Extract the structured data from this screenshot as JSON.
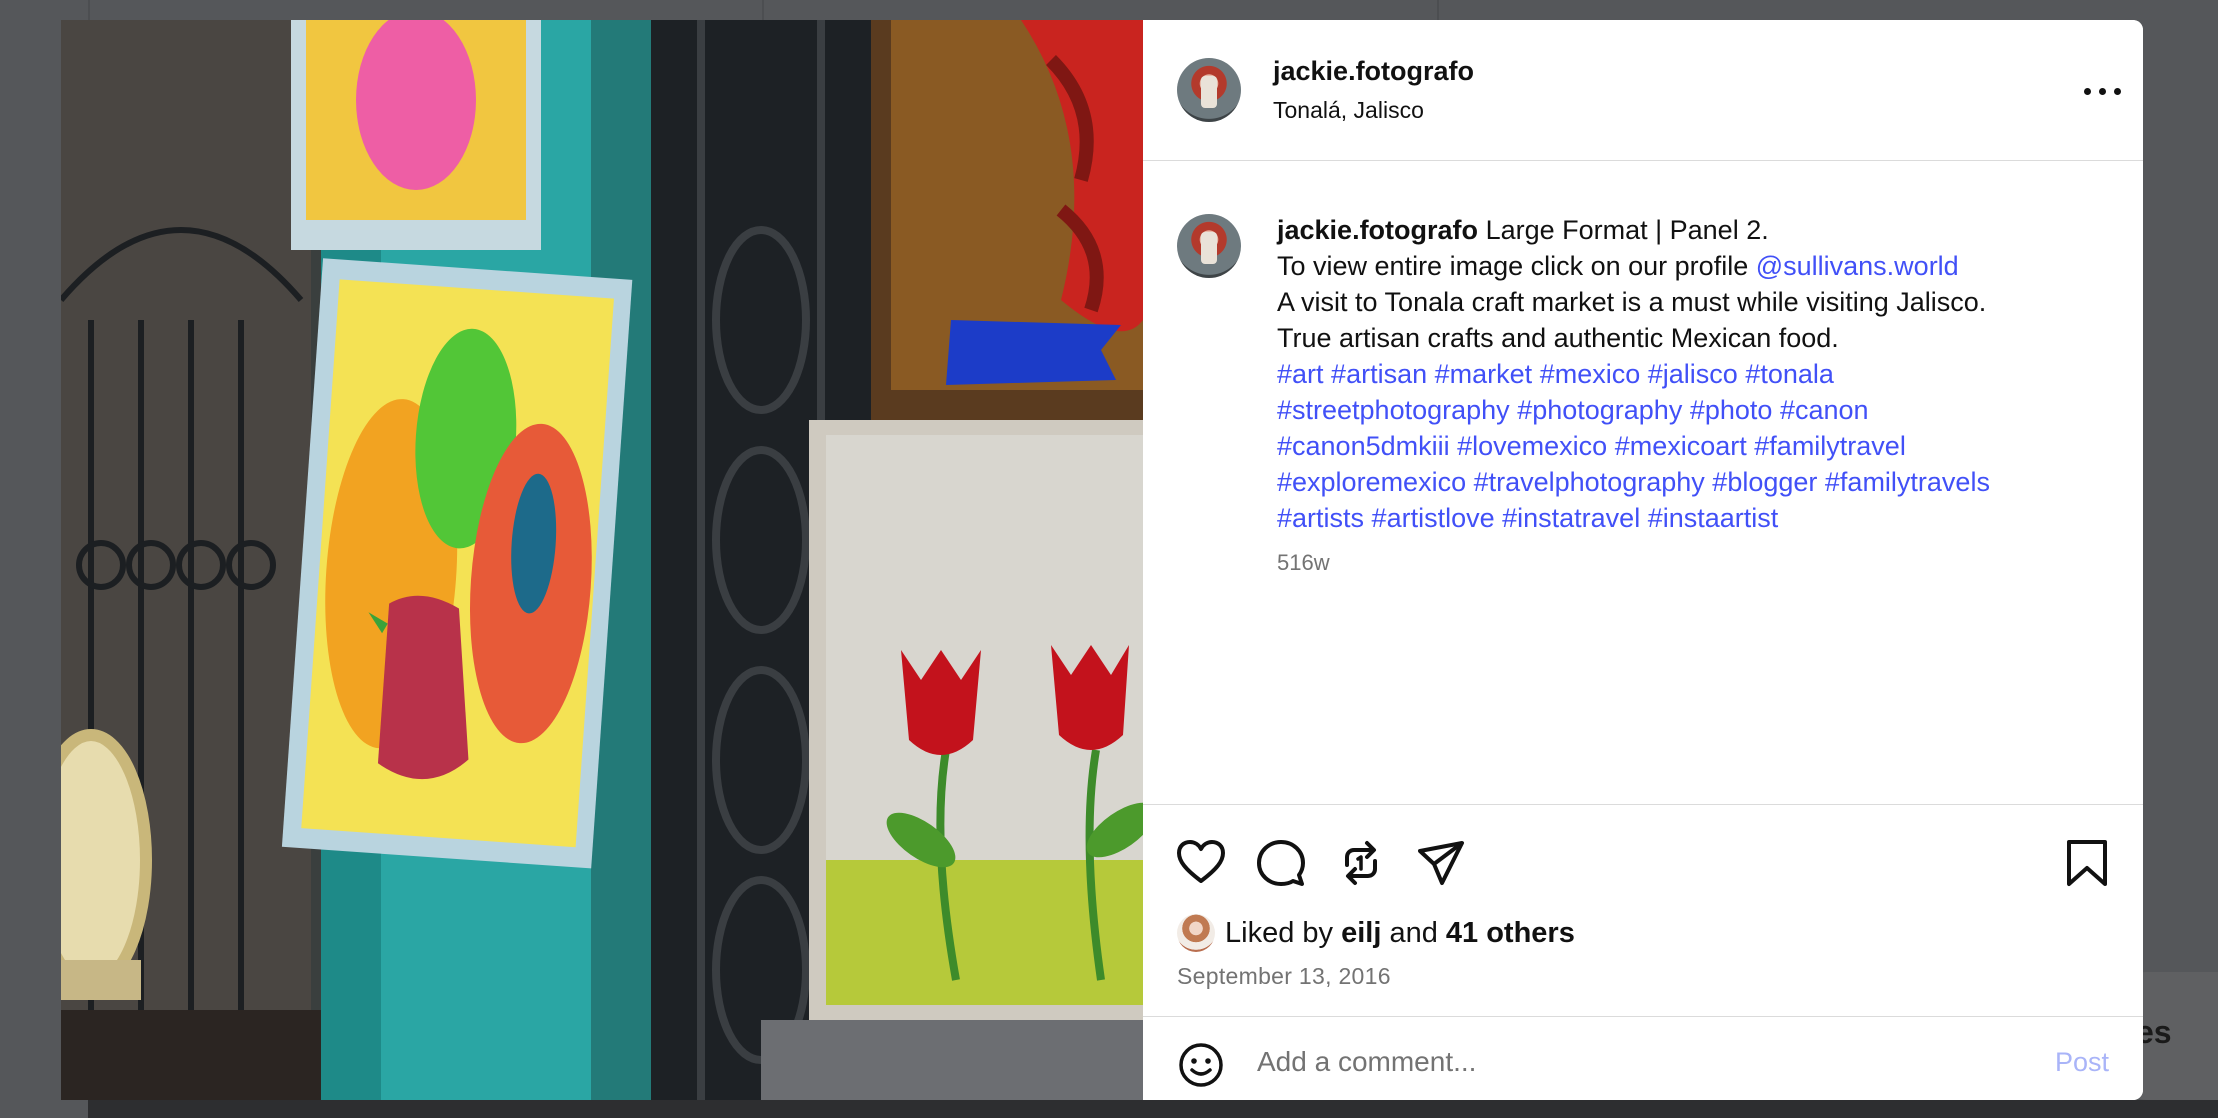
{
  "post": {
    "username": "jackie.fotografo",
    "location": "Tonalá, Jalisco",
    "more_icon": "more-horizontal-icon"
  },
  "caption": {
    "username": "jackie.fotografo",
    "line1_text": "Large Format | Panel 2.",
    "line2_text": "To view entire image click on our profile ",
    "mention": "@sullivans.world",
    "line3": "A visit to Tonala craft market is a must while visiting Jalisco.",
    "line4": "True artisan crafts and authentic Mexican food.",
    "hashtag_lines": [
      [
        "#art",
        "#artisan",
        "#market",
        "#mexico",
        "#jalisco",
        "#tonala"
      ],
      [
        "#streetphotography",
        "#photography",
        "#photo",
        "#canon"
      ],
      [
        "#canon5dmkiii",
        "#lovemexico",
        "#mexicoart",
        "#familytravel"
      ],
      [
        "#exploremexico",
        "#travelphotography",
        "#blogger",
        "#familytravels"
      ],
      [
        "#artists",
        "#artistlove",
        "#instatravel",
        "#instaartist"
      ]
    ],
    "time_ago": "516w"
  },
  "actions": {
    "icons": [
      "heart-icon",
      "comment-icon",
      "repost-icon",
      "share-icon",
      "bookmark-icon"
    ],
    "liked_prefix": "Liked by ",
    "liked_user": "eilj",
    "liked_middle": " and ",
    "liked_others": "41 others",
    "date": "September 13, 2016"
  },
  "comment_box": {
    "placeholder": "Add a comment...",
    "post_label": "Post"
  },
  "background": {
    "peek_text": "es"
  },
  "colors": {
    "link": "#4150f7",
    "muted": "#737373",
    "post_disabled": "#a9b4f8",
    "border": "#dbdbdb"
  }
}
